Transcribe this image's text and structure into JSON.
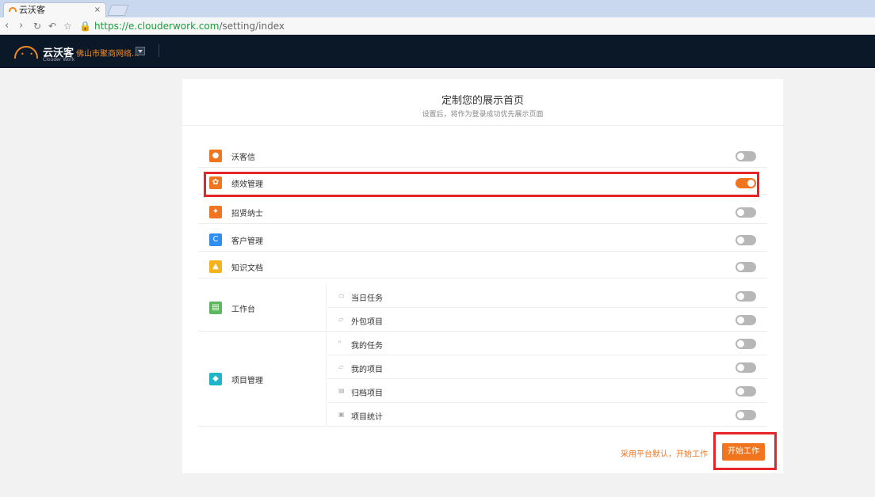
{
  "browser": {
    "tab_title": "云沃客",
    "tab_close": "×",
    "url_host": "https://e.clouderwork.com",
    "url_path": "/setting/index"
  },
  "header": {
    "brand": "云沃客",
    "brand_sub": "Clouder Work",
    "company": "佛山市聚商网络..."
  },
  "card": {
    "title": "定制您的展示首页",
    "subtitle": "设置后，将作为登录成功优先展示页面",
    "apps": [
      {
        "label": "沃客信",
        "icon": "chat-icon",
        "color": "#f0751e",
        "on": false
      },
      {
        "label": "绩效管理",
        "icon": "performance-icon",
        "color": "#f0751e",
        "on": true
      },
      {
        "label": "招贤纳士",
        "icon": "recruit-icon",
        "color": "#f0751e",
        "on": false
      },
      {
        "label": "客户管理",
        "icon": "customer-icon",
        "color": "#2f8ff0",
        "on": false
      },
      {
        "label": "知识文档",
        "icon": "knowledge-icon",
        "color": "#f5b21a",
        "on": false
      }
    ],
    "workbench": {
      "label": "工作台",
      "color": "#5cb85c",
      "items": [
        {
          "label": "当日任务",
          "icon": "calendar-icon",
          "on": false
        },
        {
          "label": "外包项目",
          "icon": "folder-icon",
          "on": false
        }
      ]
    },
    "projects": {
      "label": "项目管理",
      "color": "#1fb5c9",
      "items": [
        {
          "label": "我的任务",
          "icon": "user-icon",
          "on": false
        },
        {
          "label": "我的项目",
          "icon": "folder-icon",
          "on": false
        },
        {
          "label": "归档项目",
          "icon": "archive-icon",
          "on": false
        },
        {
          "label": "项目统计",
          "icon": "stats-icon",
          "on": false
        }
      ]
    },
    "default_link": "采用平台默认，开始工作",
    "start_button": "开始工作"
  },
  "colors": {
    "accent": "#f0751e",
    "highlight": "#e5252a",
    "header_bg": "#0b1828"
  }
}
